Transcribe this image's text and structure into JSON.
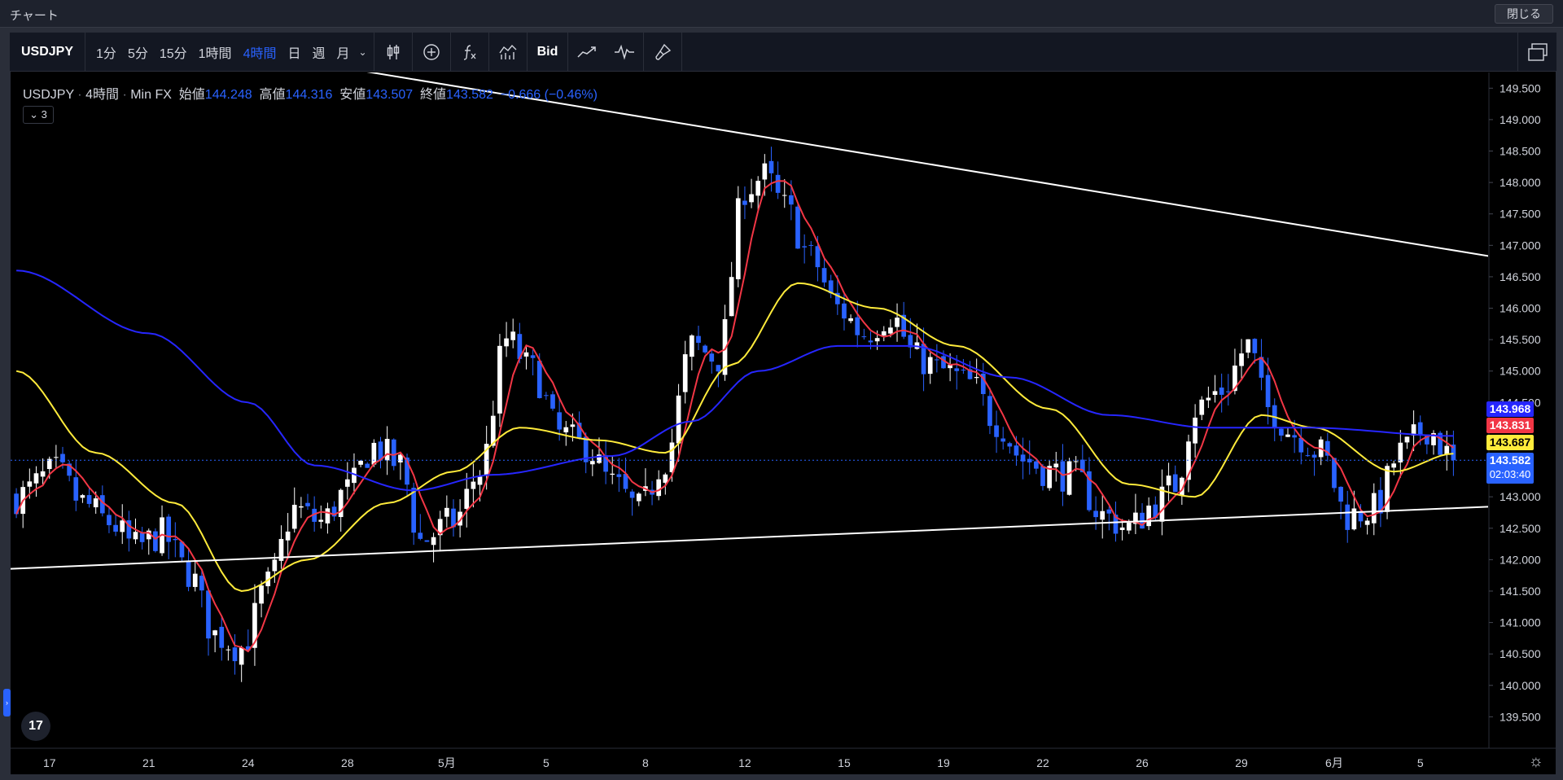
{
  "window": {
    "title": "チャート",
    "close_label": "閉じる"
  },
  "toolbar": {
    "symbol": "USDJPY",
    "intervals": [
      "1分",
      "5分",
      "15分",
      "1時間",
      "4時間",
      "日",
      "週",
      "月"
    ],
    "active_interval": "4時間",
    "bid_label": "Bid",
    "icons": [
      "candles-icon",
      "add-indicator-icon",
      "function-icon",
      "compare-icon",
      "bid-ask-icon",
      "line-chart-icon",
      "waveform-icon",
      "brush-icon"
    ]
  },
  "legend": {
    "symbol": "USDJPY",
    "interval": "4時間",
    "source": "Min FX",
    "open_label": "始値",
    "open": "144.248",
    "high_label": "高値",
    "high": "144.316",
    "low_label": "安値",
    "low": "143.507",
    "close_label": "終値",
    "close": "143.582",
    "change": "−0.666 (−0.46%)",
    "indicator_toggle": "3"
  },
  "price_tags": {
    "blue_ma": "143.968",
    "red_ma": "143.831",
    "yellow_ma": "143.687",
    "last": "143.582",
    "countdown": "02:03:40"
  },
  "colors": {
    "up": "#ffffff",
    "down": "#2962ff",
    "ma_fast": "#f23645",
    "ma_mid": "#ffeb3b",
    "ma_slow": "#2626ff",
    "trendline": "#ffffff"
  },
  "chart_data": {
    "type": "candlestick",
    "y_ticks": [
      149.5,
      149.0,
      148.5,
      148.0,
      147.5,
      147.0,
      146.5,
      146.0,
      145.5,
      145.0,
      144.5,
      143.0,
      142.5,
      142.0,
      141.5,
      141.0,
      140.5,
      140.0,
      139.5
    ],
    "y_tick_labels": [
      "149.500",
      "149.000",
      "148.500",
      "148.000",
      "147.500",
      "147.000",
      "146.500",
      "146.000",
      "145.500",
      "145.000",
      "144.500",
      "143.000",
      "142.500",
      "142.000",
      "141.500",
      "141.000",
      "140.500",
      "140.000",
      "139.500"
    ],
    "ylim": [
      139.0,
      149.75
    ],
    "x_labels": [
      "17",
      "21",
      "24",
      "28",
      "5月",
      "5",
      "8",
      "12",
      "15",
      "19",
      "22",
      "26",
      "29",
      "6月",
      "5"
    ],
    "x_label_bar_index": [
      5,
      20,
      35,
      50,
      65,
      80,
      95,
      110,
      125,
      140,
      155,
      170,
      185,
      199,
      212
    ],
    "bar_count": 218,
    "anchors": [
      [
        0,
        143.0
      ],
      [
        6,
        143.4
      ],
      [
        10,
        142.9
      ],
      [
        14,
        142.6
      ],
      [
        18,
        142.2
      ],
      [
        22,
        142.4
      ],
      [
        26,
        141.8
      ],
      [
        30,
        140.8
      ],
      [
        34,
        140.6
      ],
      [
        38,
        141.6
      ],
      [
        42,
        142.8
      ],
      [
        46,
        142.6
      ],
      [
        50,
        143.1
      ],
      [
        54,
        143.8
      ],
      [
        58,
        143.5
      ],
      [
        61,
        142.3
      ],
      [
        66,
        142.6
      ],
      [
        70,
        143.4
      ],
      [
        74,
        145.5
      ],
      [
        78,
        145.0
      ],
      [
        82,
        144.0
      ],
      [
        86,
        143.8
      ],
      [
        90,
        143.2
      ],
      [
        94,
        142.8
      ],
      [
        98,
        143.6
      ],
      [
        102,
        145.4
      ],
      [
        106,
        145.2
      ],
      [
        110,
        147.9
      ],
      [
        113,
        148.1
      ],
      [
        116,
        147.6
      ],
      [
        120,
        146.8
      ],
      [
        124,
        146.0
      ],
      [
        128,
        145.6
      ],
      [
        132,
        145.9
      ],
      [
        136,
        145.2
      ],
      [
        140,
        145.0
      ],
      [
        144,
        144.8
      ],
      [
        148,
        144.2
      ],
      [
        152,
        143.6
      ],
      [
        156,
        143.4
      ],
      [
        160,
        143.3
      ],
      [
        164,
        142.7
      ],
      [
        168,
        142.5
      ],
      [
        172,
        142.9
      ],
      [
        175,
        143.2
      ],
      [
        178,
        144.4
      ],
      [
        182,
        144.7
      ],
      [
        186,
        145.4
      ],
      [
        189,
        144.4
      ],
      [
        193,
        144.0
      ],
      [
        197,
        143.7
      ],
      [
        201,
        142.7
      ],
      [
        205,
        142.8
      ],
      [
        209,
        143.7
      ],
      [
        213,
        144.1
      ],
      [
        217,
        143.58
      ]
    ],
    "ma_slow_anchors": [
      [
        0,
        146.6
      ],
      [
        20,
        145.6
      ],
      [
        35,
        144.5
      ],
      [
        45,
        143.5
      ],
      [
        60,
        143.1
      ],
      [
        72,
        143.35
      ],
      [
        90,
        143.65
      ],
      [
        102,
        144.2
      ],
      [
        112,
        145.0
      ],
      [
        124,
        145.4
      ],
      [
        135,
        145.4
      ],
      [
        150,
        144.9
      ],
      [
        165,
        144.3
      ],
      [
        180,
        144.1
      ],
      [
        195,
        144.1
      ],
      [
        217,
        143.968
      ]
    ],
    "ma_mid_anchors": [
      [
        0,
        145.0
      ],
      [
        12,
        143.7
      ],
      [
        24,
        142.9
      ],
      [
        34,
        141.5
      ],
      [
        44,
        142.0
      ],
      [
        56,
        142.9
      ],
      [
        66,
        143.4
      ],
      [
        76,
        144.1
      ],
      [
        88,
        143.9
      ],
      [
        98,
        143.7
      ],
      [
        108,
        145.1
      ],
      [
        118,
        146.4
      ],
      [
        130,
        146.0
      ],
      [
        142,
        145.4
      ],
      [
        156,
        144.4
      ],
      [
        168,
        143.2
      ],
      [
        178,
        143.0
      ],
      [
        188,
        144.3
      ],
      [
        196,
        144.1
      ],
      [
        208,
        143.4
      ],
      [
        217,
        143.687
      ]
    ],
    "trendlines": [
      {
        "points": [
          [
            -2,
            141.85
          ],
          [
            224,
            142.85
          ]
        ]
      },
      {
        "points": [
          [
            45,
            149.9
          ],
          [
            224,
            146.8
          ]
        ]
      }
    ],
    "last_price": 143.582
  }
}
